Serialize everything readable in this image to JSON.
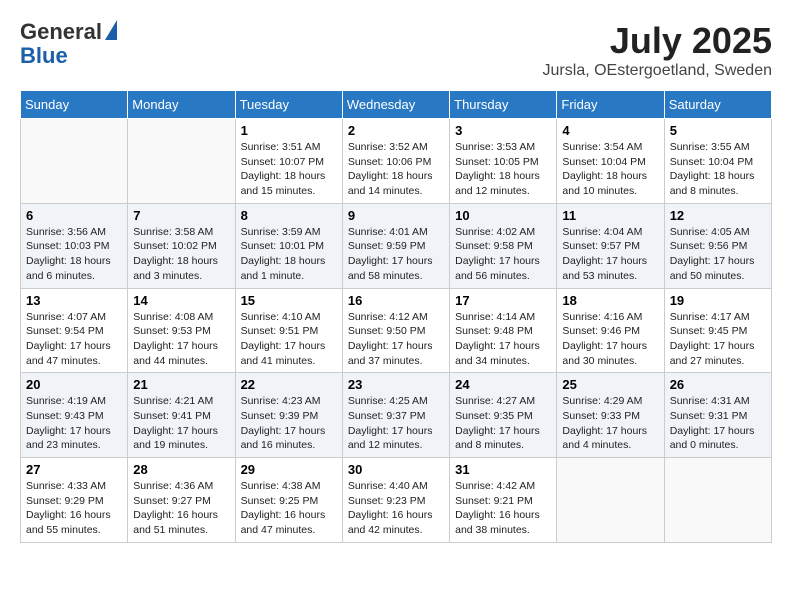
{
  "header": {
    "logo_line1": "General",
    "logo_line2": "Blue",
    "month_year": "July 2025",
    "location": "Jursla, OEstergoetland, Sweden"
  },
  "weekdays": [
    "Sunday",
    "Monday",
    "Tuesday",
    "Wednesday",
    "Thursday",
    "Friday",
    "Saturday"
  ],
  "weeks": [
    [
      {
        "day": "",
        "info": ""
      },
      {
        "day": "",
        "info": ""
      },
      {
        "day": "1",
        "info": "Sunrise: 3:51 AM\nSunset: 10:07 PM\nDaylight: 18 hours and 15 minutes."
      },
      {
        "day": "2",
        "info": "Sunrise: 3:52 AM\nSunset: 10:06 PM\nDaylight: 18 hours and 14 minutes."
      },
      {
        "day": "3",
        "info": "Sunrise: 3:53 AM\nSunset: 10:05 PM\nDaylight: 18 hours and 12 minutes."
      },
      {
        "day": "4",
        "info": "Sunrise: 3:54 AM\nSunset: 10:04 PM\nDaylight: 18 hours and 10 minutes."
      },
      {
        "day": "5",
        "info": "Sunrise: 3:55 AM\nSunset: 10:04 PM\nDaylight: 18 hours and 8 minutes."
      }
    ],
    [
      {
        "day": "6",
        "info": "Sunrise: 3:56 AM\nSunset: 10:03 PM\nDaylight: 18 hours and 6 minutes."
      },
      {
        "day": "7",
        "info": "Sunrise: 3:58 AM\nSunset: 10:02 PM\nDaylight: 18 hours and 3 minutes."
      },
      {
        "day": "8",
        "info": "Sunrise: 3:59 AM\nSunset: 10:01 PM\nDaylight: 18 hours and 1 minute."
      },
      {
        "day": "9",
        "info": "Sunrise: 4:01 AM\nSunset: 9:59 PM\nDaylight: 17 hours and 58 minutes."
      },
      {
        "day": "10",
        "info": "Sunrise: 4:02 AM\nSunset: 9:58 PM\nDaylight: 17 hours and 56 minutes."
      },
      {
        "day": "11",
        "info": "Sunrise: 4:04 AM\nSunset: 9:57 PM\nDaylight: 17 hours and 53 minutes."
      },
      {
        "day": "12",
        "info": "Sunrise: 4:05 AM\nSunset: 9:56 PM\nDaylight: 17 hours and 50 minutes."
      }
    ],
    [
      {
        "day": "13",
        "info": "Sunrise: 4:07 AM\nSunset: 9:54 PM\nDaylight: 17 hours and 47 minutes."
      },
      {
        "day": "14",
        "info": "Sunrise: 4:08 AM\nSunset: 9:53 PM\nDaylight: 17 hours and 44 minutes."
      },
      {
        "day": "15",
        "info": "Sunrise: 4:10 AM\nSunset: 9:51 PM\nDaylight: 17 hours and 41 minutes."
      },
      {
        "day": "16",
        "info": "Sunrise: 4:12 AM\nSunset: 9:50 PM\nDaylight: 17 hours and 37 minutes."
      },
      {
        "day": "17",
        "info": "Sunrise: 4:14 AM\nSunset: 9:48 PM\nDaylight: 17 hours and 34 minutes."
      },
      {
        "day": "18",
        "info": "Sunrise: 4:16 AM\nSunset: 9:46 PM\nDaylight: 17 hours and 30 minutes."
      },
      {
        "day": "19",
        "info": "Sunrise: 4:17 AM\nSunset: 9:45 PM\nDaylight: 17 hours and 27 minutes."
      }
    ],
    [
      {
        "day": "20",
        "info": "Sunrise: 4:19 AM\nSunset: 9:43 PM\nDaylight: 17 hours and 23 minutes."
      },
      {
        "day": "21",
        "info": "Sunrise: 4:21 AM\nSunset: 9:41 PM\nDaylight: 17 hours and 19 minutes."
      },
      {
        "day": "22",
        "info": "Sunrise: 4:23 AM\nSunset: 9:39 PM\nDaylight: 17 hours and 16 minutes."
      },
      {
        "day": "23",
        "info": "Sunrise: 4:25 AM\nSunset: 9:37 PM\nDaylight: 17 hours and 12 minutes."
      },
      {
        "day": "24",
        "info": "Sunrise: 4:27 AM\nSunset: 9:35 PM\nDaylight: 17 hours and 8 minutes."
      },
      {
        "day": "25",
        "info": "Sunrise: 4:29 AM\nSunset: 9:33 PM\nDaylight: 17 hours and 4 minutes."
      },
      {
        "day": "26",
        "info": "Sunrise: 4:31 AM\nSunset: 9:31 PM\nDaylight: 17 hours and 0 minutes."
      }
    ],
    [
      {
        "day": "27",
        "info": "Sunrise: 4:33 AM\nSunset: 9:29 PM\nDaylight: 16 hours and 55 minutes."
      },
      {
        "day": "28",
        "info": "Sunrise: 4:36 AM\nSunset: 9:27 PM\nDaylight: 16 hours and 51 minutes."
      },
      {
        "day": "29",
        "info": "Sunrise: 4:38 AM\nSunset: 9:25 PM\nDaylight: 16 hours and 47 minutes."
      },
      {
        "day": "30",
        "info": "Sunrise: 4:40 AM\nSunset: 9:23 PM\nDaylight: 16 hours and 42 minutes."
      },
      {
        "day": "31",
        "info": "Sunrise: 4:42 AM\nSunset: 9:21 PM\nDaylight: 16 hours and 38 minutes."
      },
      {
        "day": "",
        "info": ""
      },
      {
        "day": "",
        "info": ""
      }
    ]
  ]
}
